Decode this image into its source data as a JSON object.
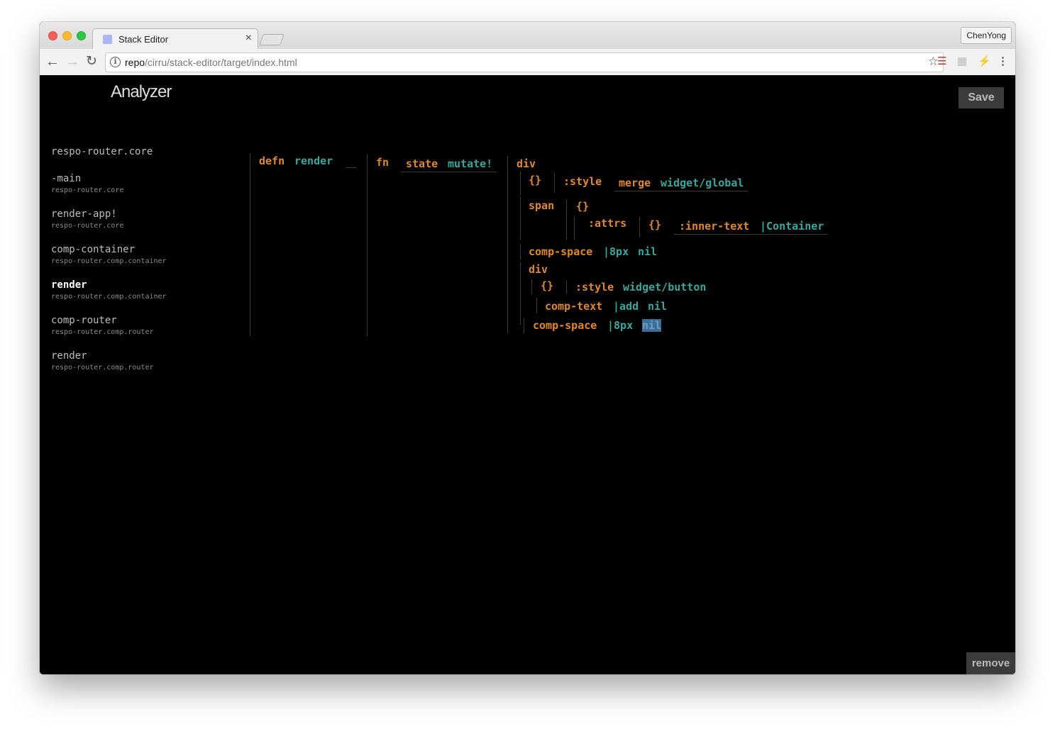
{
  "browser": {
    "tab_title": "Stack Editor",
    "profile": "ChenYong",
    "url_host": "repo",
    "url_path": "/cirru/stack-editor/target/index.html"
  },
  "app": {
    "title": "Analyzer",
    "save_label": "Save",
    "remove_label": "remove"
  },
  "stack": [
    {
      "name": "respo-router.core",
      "ns": ""
    },
    {
      "name": "-main",
      "ns": "respo-router.core"
    },
    {
      "name": "render-app!",
      "ns": "respo-router.core"
    },
    {
      "name": "comp-container",
      "ns": "respo-router.comp.container"
    },
    {
      "name": "render",
      "ns": "respo-router.comp.container",
      "active": true
    },
    {
      "name": "comp-router",
      "ns": "respo-router.comp.router"
    },
    {
      "name": "render",
      "ns": "respo-router.comp.router"
    }
  ],
  "code": {
    "defn": "defn",
    "fn_name": "render",
    "fn": "fn",
    "arg_state": "state",
    "arg_mutate": "mutate!",
    "div1": "div",
    "map1": "{}",
    "style1": ":style",
    "merge": "merge",
    "widget_global": "widget/global",
    "span": "span",
    "map2": "{}",
    "attrs": ":attrs",
    "map3": "{}",
    "inner_text": ":inner-text",
    "container": "|Container",
    "comp_space1": "comp-space",
    "px1": "|8px",
    "nil1": "nil",
    "div2": "div",
    "map4": "{}",
    "style2": ":style",
    "widget_button": "widget/button",
    "comp_text": "comp-text",
    "add": "|add",
    "nil2": "nil",
    "comp_space2": "comp-space",
    "px2": "|8px",
    "nil3": "nil"
  },
  "colors": {
    "keyword": "#e0892b",
    "identifier": "#37a89c",
    "selection": "#3c6d97"
  }
}
